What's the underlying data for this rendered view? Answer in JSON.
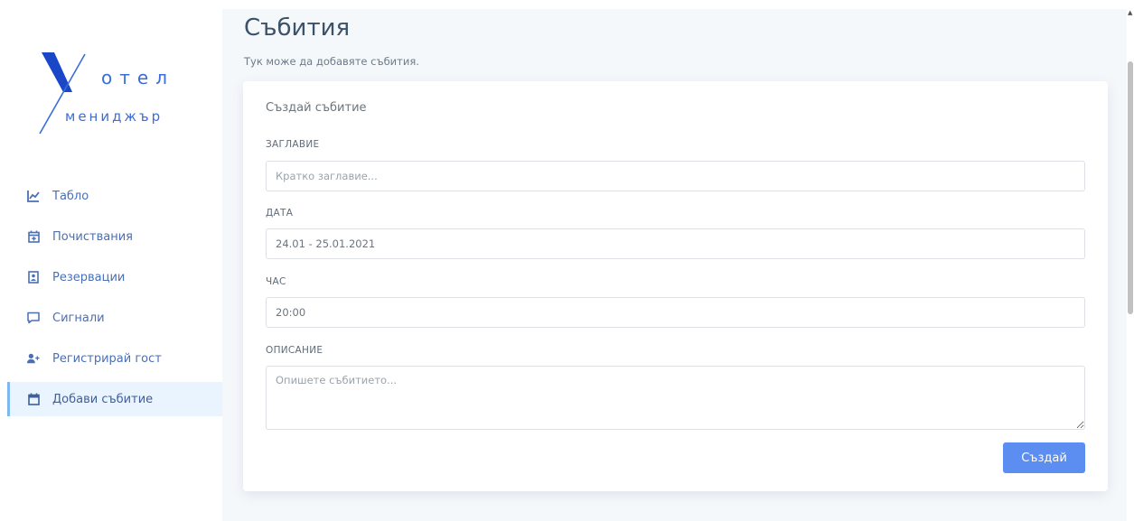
{
  "brand": {
    "line1": "отел",
    "line2": "мениджър",
    "accent_color": "#3b6ddb",
    "mark_color": "#1a46c8"
  },
  "sidebar": {
    "items": [
      {
        "label": "Табло",
        "icon": "chart-line-icon",
        "active": false
      },
      {
        "label": "Почиствания",
        "icon": "calendar-plus-icon",
        "active": false
      },
      {
        "label": "Резервации",
        "icon": "address-book-icon",
        "active": false
      },
      {
        "label": "Сигнали",
        "icon": "comment-icon",
        "active": false
      },
      {
        "label": "Регистрирай гост",
        "icon": "user-plus-icon",
        "active": false
      },
      {
        "label": "Добави събитие",
        "icon": "calendar-icon",
        "active": true
      }
    ]
  },
  "page": {
    "title": "Събития",
    "subtitle": "Тук може да добавяте събития."
  },
  "form": {
    "card_title": "Създай събитие",
    "title_label": "ЗАГЛАВИЕ",
    "title_placeholder": "Кратко заглавие...",
    "date_label": "ДАТА",
    "date_value": "24.01 - 25.01.2021",
    "time_label": "ЧАС",
    "time_value": "20:00",
    "description_label": "ОПИСАНИЕ",
    "description_placeholder": "Опишете събитието...",
    "submit_label": "Създай",
    "submit_color": "#5b8ef0"
  }
}
